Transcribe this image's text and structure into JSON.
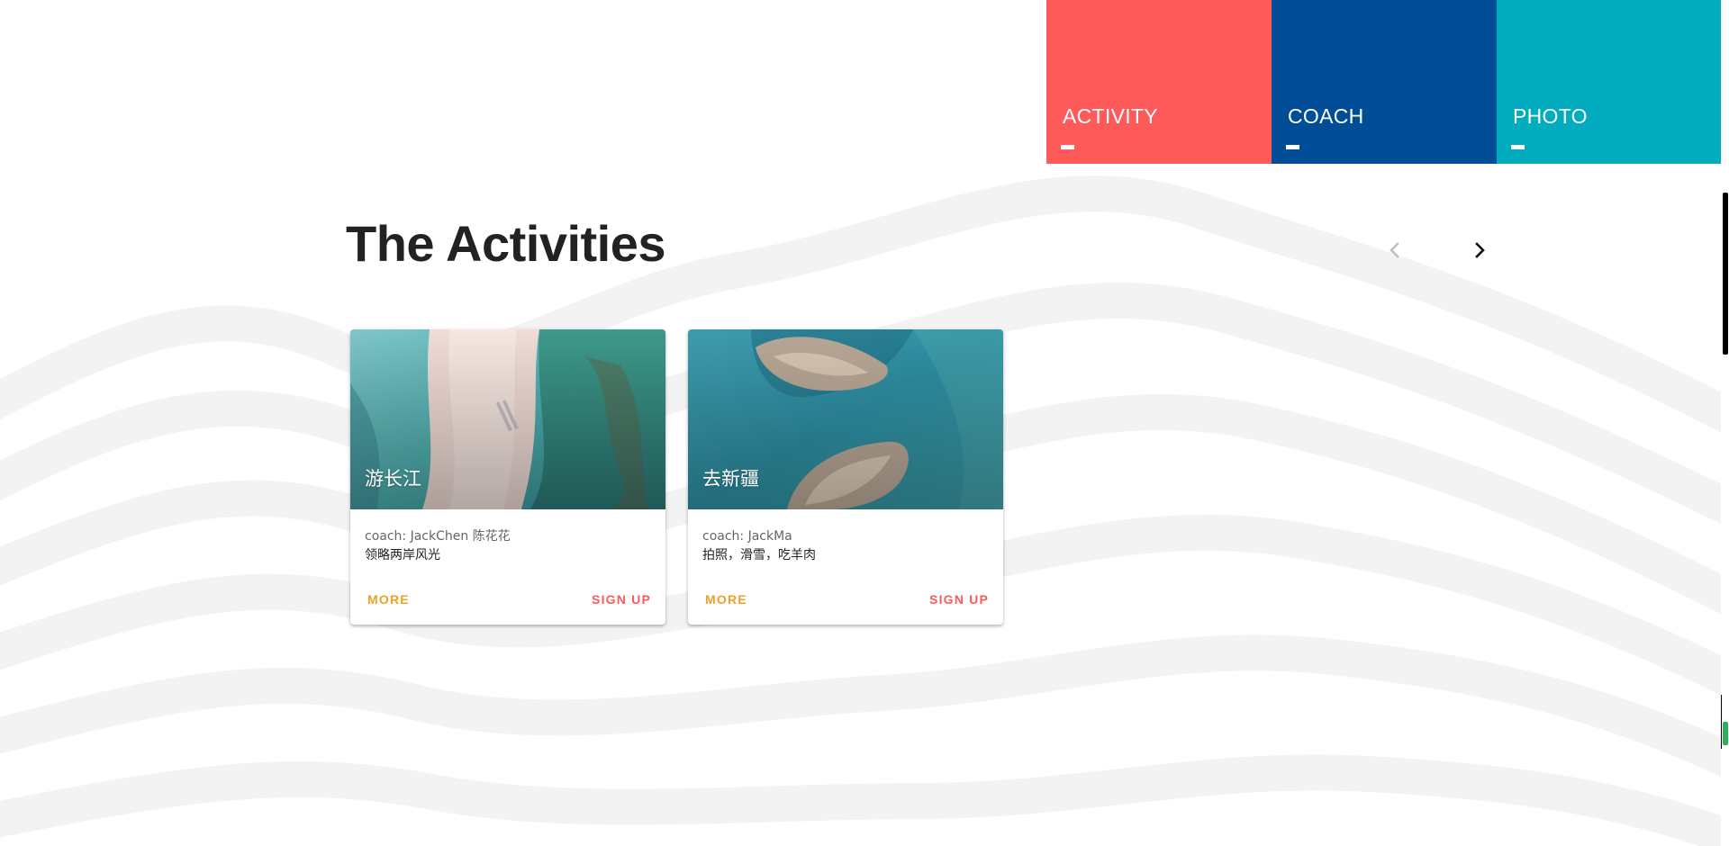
{
  "nav": {
    "tiles": [
      {
        "label": "ACTIVITY",
        "color": "#fe5a5a"
      },
      {
        "label": "COACH",
        "color": "#014d98"
      },
      {
        "label": "PHOTO",
        "color": "#00acbd"
      }
    ]
  },
  "section": {
    "title": "The Activities",
    "prev_icon": "chevron-left-icon",
    "next_icon": "chevron-right-icon"
  },
  "cards": [
    {
      "title": "游长江",
      "coach": "coach: JackChen 陈花花",
      "description": "领略两岸风光",
      "more_label": "MORE",
      "signup_label": "SIGN UP"
    },
    {
      "title": "去新疆",
      "coach": "coach: JackMa",
      "description": "拍照，滑雪，吃羊肉",
      "more_label": "MORE",
      "signup_label": "SIGN UP"
    }
  ],
  "colors": {
    "accent_orange": "#f0a027",
    "accent_red": "#fe5a5a",
    "heading": "#222222",
    "wave": "#f3f3f3"
  }
}
